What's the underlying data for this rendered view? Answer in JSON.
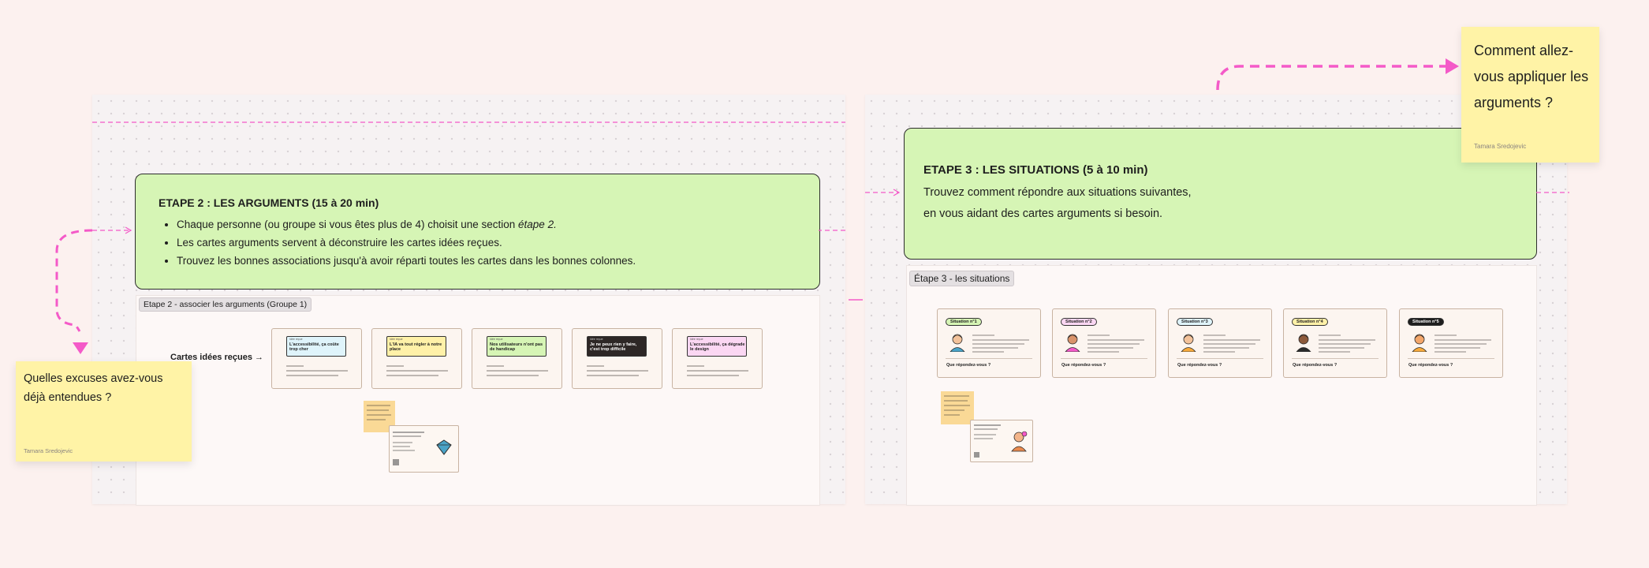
{
  "step2": {
    "title": "ETAPE 2 : LES ARGUMENTS (15 à 20 min)",
    "bullets": [
      {
        "text": "Chaque personne (ou groupe si vous êtes plus de 4) choisit une section ",
        "em": "étape 2."
      },
      {
        "text": "Les cartes arguments servent à déconstruire les cartes idées reçues.",
        "em": ""
      },
      {
        "text": "Trouvez les bonnes associations jusqu'à avoir réparti toutes les cartes dans les bonnes colonnes.",
        "em": ""
      }
    ],
    "section_label": "Etape 2 - associer les arguments (Groupe 1)",
    "row_label": "Cartes idées reçues →",
    "cards": [
      {
        "tag": "Idée reçue",
        "title": "L'accessibilité, ça coûte trop cher",
        "color": "#dff4fb"
      },
      {
        "tag": "Idée reçue",
        "title": "L'IA va tout régler à notre place",
        "color": "#fff1a8"
      },
      {
        "tag": "Idée reçue",
        "title": "Nos utilisateurs n'ont pas de handicap",
        "color": "#d6f5b5"
      },
      {
        "tag": "Idée reçue",
        "title": "Je ne peux rien y faire, c'est trop difficile",
        "color": "#2d2726"
      },
      {
        "tag": "Idée reçue",
        "title": "L'accessibilité, ça dégrade le design",
        "color": "#fbd7f3"
      }
    ]
  },
  "step3": {
    "title": "ETAPE 3 : LES SITUATIONS (5 à 10 min)",
    "line1": "Trouvez comment répondre aux situations suivantes,",
    "line2": "en vous aidant des cartes arguments si besoin.",
    "section_label": "Étape 3 - les situations",
    "question": "Que répondez-vous ?",
    "situations": [
      {
        "badge": "Situation n°1",
        "color": "#d6f5b5"
      },
      {
        "badge": "Situation n°2",
        "color": "#fbd7f3"
      },
      {
        "badge": "Situation n°3",
        "color": "#dff4fb"
      },
      {
        "badge": "Situation n°4",
        "color": "#fff1a8"
      },
      {
        "badge": "Situation n°5",
        "color": "#1e1e1e"
      }
    ]
  },
  "stickies": {
    "left": {
      "text": "Quelles excuses avez-vous déjà entendues ?",
      "author": "Tamara Sredojevic"
    },
    "right": {
      "text": "Comment allez-vous appliquer les arguments ?",
      "author": "Tamara Sredojevic"
    }
  },
  "colors": {
    "accent_pink": "#f45ac8",
    "green": "#d6f5b5",
    "sticky": "#fff3a6"
  }
}
